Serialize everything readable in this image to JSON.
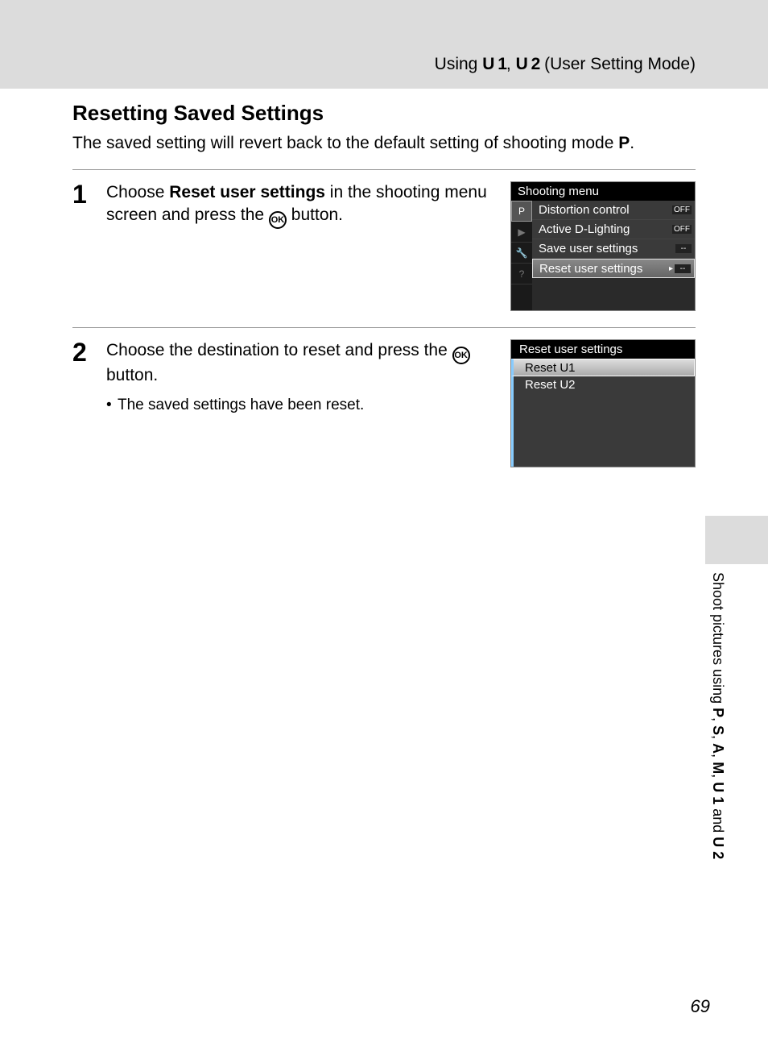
{
  "header": {
    "prefix": "Using ",
    "u1": "U 1",
    "sep": ", ",
    "u2": "U 2",
    "suffix": " (User Setting Mode)"
  },
  "title": "Resetting Saved Settings",
  "intro_a": "The saved setting will revert back to the default setting of shooting mode ",
  "intro_mode": "P",
  "intro_b": ".",
  "steps": [
    {
      "num": "1",
      "line1a": "Choose ",
      "line1b": "Reset user settings",
      "line1c": " in the shooting menu screen and press the ",
      "ok": "OK",
      "line1d": " button."
    },
    {
      "num": "2",
      "line1a": "Choose the destination to reset and press the ",
      "ok": "OK",
      "line1b": " button.",
      "bullet": "The saved settings have been reset."
    }
  ],
  "lcd1": {
    "title": "Shooting menu",
    "tabs": [
      "P",
      "▶",
      "🔧",
      "?"
    ],
    "rows": [
      {
        "label": "Distortion control",
        "val": "OFF",
        "sel": false
      },
      {
        "label": "Active D-Lighting",
        "val": "OFF",
        "sel": false
      },
      {
        "label": "Save user settings",
        "val": "--",
        "sel": false
      },
      {
        "label": "Reset user settings",
        "val": "--",
        "sel": true,
        "arrow": "▸"
      }
    ]
  },
  "lcd2": {
    "title": "Reset user settings",
    "rows": [
      {
        "label": "Reset U1",
        "sel": true
      },
      {
        "label": "Reset U2",
        "sel": false
      }
    ]
  },
  "side": {
    "text_a": "Shoot pictures using ",
    "p": "P",
    "s": "S",
    "a": "A",
    "m": "M",
    "u1": "U 1",
    "and": " and ",
    "u2": "U 2",
    "comma": ", "
  },
  "page": "69"
}
